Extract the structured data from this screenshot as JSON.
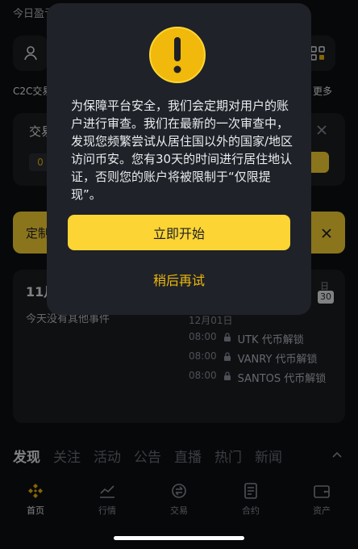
{
  "header": {
    "today_profit_label": "今日盈亏"
  },
  "quick_links": {
    "c2c_label": "C2C交易",
    "more_label": "更多"
  },
  "banner": {
    "text": "交易",
    "badge": "0"
  },
  "notice": {
    "text": "定制"
  },
  "calendar": {
    "month_label": "11月",
    "no_events": "今天没有其他事件",
    "day_header": "日",
    "day_number": "30",
    "date": "12月01日",
    "events": [
      {
        "time": "08:00",
        "label": "UTK 代币解锁"
      },
      {
        "time": "08:00",
        "label": "VANRY 代币解锁"
      },
      {
        "time": "08:00",
        "label": "SANTOS 代币解锁"
      }
    ]
  },
  "section_tabs": [
    "发现",
    "关注",
    "活动",
    "公告",
    "直播",
    "热门",
    "新闻"
  ],
  "bottom_nav": [
    {
      "label": "首页",
      "icon": "binance-logo-icon"
    },
    {
      "label": "行情",
      "icon": "chart-icon"
    },
    {
      "label": "交易",
      "icon": "trade-icon"
    },
    {
      "label": "合约",
      "icon": "futures-icon"
    },
    {
      "label": "资产",
      "icon": "wallet-icon"
    }
  ],
  "modal": {
    "icon": "warning-icon",
    "message": "为保障平台安全，我们会定期对用户的账户进行审查。我们在最新的一次审查中，发现您频繁尝试从居住国以外的国家/地区访问币安。您有30天的时间进行居住地认证，否则您的账户将被限制于“仅限提现”。",
    "primary_button": "立即开始",
    "secondary_button": "稍后再试"
  },
  "colors": {
    "accent": "#fcd535",
    "accent_text": "#f0b90b",
    "background": "#0e0f12",
    "modal_bg": "#1f2228"
  }
}
